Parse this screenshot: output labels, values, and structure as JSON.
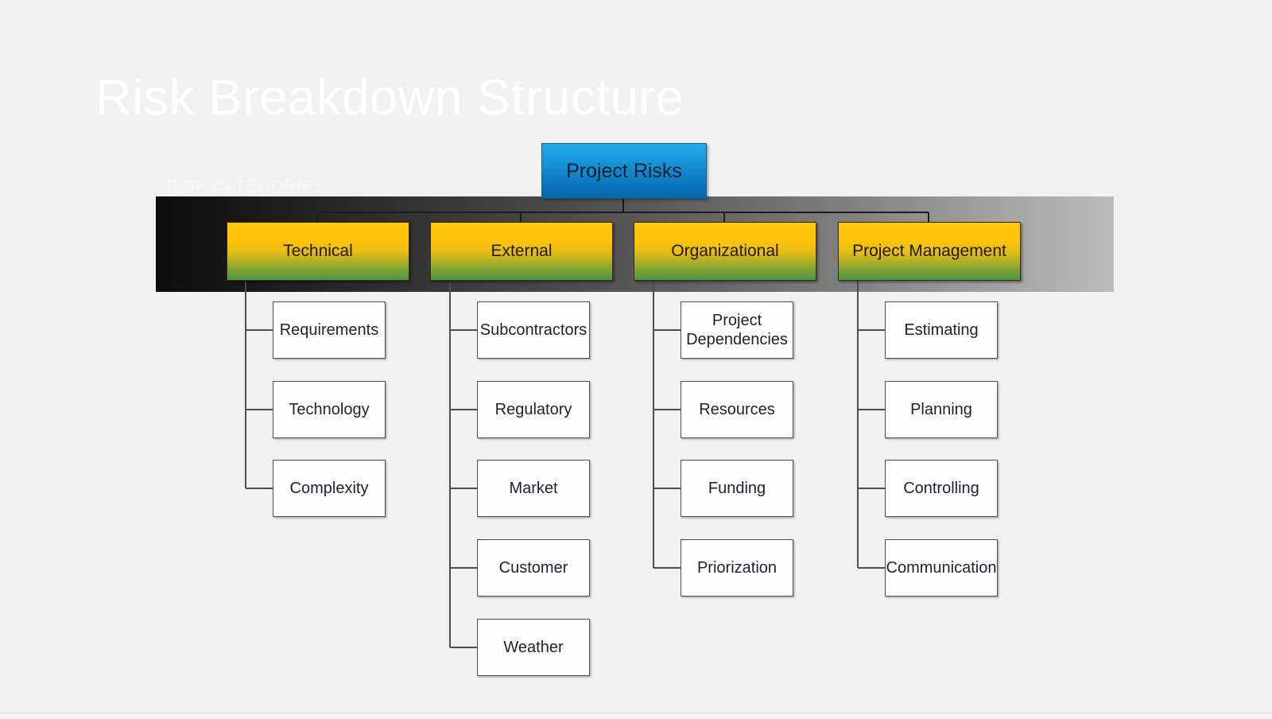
{
  "slide": {
    "title": "Risk Breakdown Structure",
    "section_label": "RISK CATEGORIES",
    "background_color": "#f1f1f1",
    "title_color": "#ffffff"
  },
  "chart_data": {
    "type": "diagram",
    "diagram_kind": "risk-breakdown-structure",
    "title": "Risk Breakdown Structure",
    "root": "Project Risks",
    "categories": [
      "Technical",
      "External",
      "Organizational",
      "Project Management"
    ],
    "children": {
      "Technical": [
        "Requirements",
        "Technology",
        "Complexity"
      ],
      "External": [
        "Subcontractors",
        "Regulatory",
        "Market",
        "Customer",
        "Weather"
      ],
      "Organizational": [
        "Project Dependencies",
        "Resources",
        "Funding",
        "Priorization"
      ],
      "Project Management": [
        "Estimating",
        "Planning",
        "Controlling",
        "Communication"
      ]
    }
  },
  "root_node": {
    "label": "Project Risks",
    "color_top": "#27abe8",
    "color_bottom": "#0a64b0"
  },
  "banner": {
    "gradient_from": "#0d0d0d",
    "gradient_to": "#bcbcbc"
  },
  "category_style": {
    "color_top": "#ffc60b",
    "color_bottom": "#4e9641"
  },
  "columns": [
    {
      "category": "Technical",
      "leaves": [
        {
          "label": "Requirements"
        },
        {
          "label": "Technology"
        },
        {
          "label": "Complexity"
        }
      ]
    },
    {
      "category": "External",
      "leaves": [
        {
          "label": "Subcontractors"
        },
        {
          "label": "Regulatory"
        },
        {
          "label": "Market"
        },
        {
          "label": "Customer"
        },
        {
          "label": "Weather"
        }
      ]
    },
    {
      "category": "Organizational",
      "leaves": [
        {
          "label": "Project\nDependencies",
          "line1": "Project",
          "line2": "Dependencies"
        },
        {
          "label": "Resources"
        },
        {
          "label": "Funding"
        },
        {
          "label": "Priorization"
        }
      ]
    },
    {
      "category": "Project Management",
      "leaves": [
        {
          "label": "Estimating"
        },
        {
          "label": "Planning"
        },
        {
          "label": "Controlling"
        },
        {
          "label": "Communication"
        }
      ]
    }
  ]
}
